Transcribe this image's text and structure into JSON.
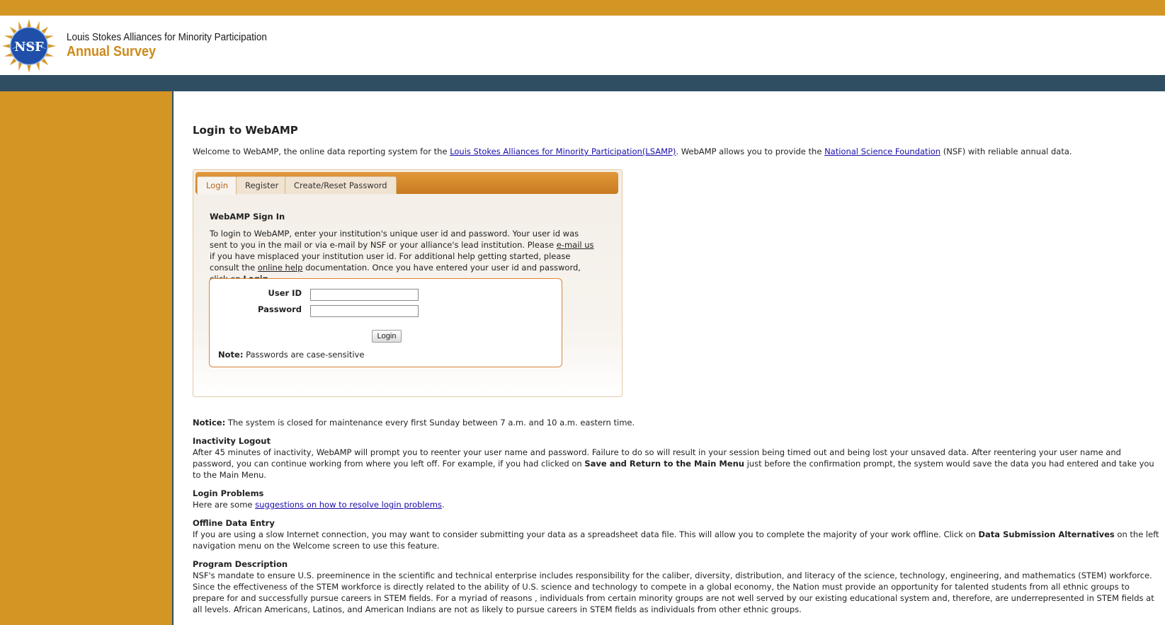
{
  "header": {
    "logo_label": "NSF",
    "title_line1": "Louis Stokes Alliances for Minority Participation",
    "title_line2": "Annual Survey"
  },
  "main": {
    "page_title": "Login to WebAMP",
    "welcome_prefix": "Welcome to WebAMP, the online data reporting system for the ",
    "lsamp_link": "Louis Stokes Alliances for Minority Participation(LSAMP)",
    "welcome_middle": ". WebAMP allows you to provide the ",
    "nsf_link": "National Science Foundation",
    "welcome_suffix": " (NSF) with reliable annual data."
  },
  "tabs": [
    "Login",
    "Register",
    "Create/Reset Password"
  ],
  "signin": {
    "title": "WebAMP Sign In",
    "text_1": "To login to WebAMP, enter your institution's unique user id and password. Your user id was sent to you in the mail or via e-mail by NSF or your alliance's lead institution. Please ",
    "email_link": "e-mail us",
    "text_2": " if you have misplaced your institution user id. For additional help getting started, please consult the ",
    "help_link": "online help",
    "text_3": " documentation. Once you have entered your user id and password, click on ",
    "text_bold": "Login.",
    "user_id_label": "User ID",
    "password_label": "Password",
    "user_id_value": "",
    "password_value": "",
    "login_button": "Login",
    "note_label": "Note:",
    "note_text": " Passwords are case-sensitive"
  },
  "notice": {
    "label": "Notice:",
    "text": " The system is closed for maintenance every first Sunday between 7 a.m. and 10 a.m. eastern time."
  },
  "inactivity": {
    "title": "Inactivity Logout",
    "text_1": "After 45 minutes of inactivity, WebAMP will prompt you to reenter your user name and password. Failure to do so will result in your session being timed out and being lost your unsaved data. After reentering your user name and password, you can continue working from where you left off. For example, if you had clicked on ",
    "bold": "Save and Return to the Main Menu",
    "text_2": " just before the confirmation prompt, the system would save the data you had entered and take you to the Main Menu."
  },
  "login_problems": {
    "title": "Login Problems",
    "prefix": "Here are some ",
    "link": "suggestions on how to resolve login problems",
    "suffix": "."
  },
  "offline": {
    "title": "Offline Data Entry",
    "text_1": "If you are using a slow Internet connection, you may want to consider submitting your data as a spreadsheet data file. This will allow you to complete the majority of your work offline. Click on ",
    "bold": "Data Submission Alternatives",
    "text_2": " on the left navigation menu on the Welcome screen to use this feature."
  },
  "program": {
    "title": "Program Description",
    "text": "NSF's mandate to ensure U.S. preeminence in the scientific and technical enterprise includes responsibility for the caliber, diversity, distribution, and literacy of the science, technology, engineering, and mathematics (STEM) workforce. Since the effectiveness of the STEM workforce is directly related to the ability of U.S. science and technology to compete in a global economy, the Nation must provide an opportunity for talented students from all ethnic groups to prepare for and successfully pursue careers in STEM fields. For a myriad of reasons , individuals from certain minority groups are not well served by our existing educational system and, therefore, are underrepresented in STEM fields at all levels. African Americans, Latinos, and American Indians are not as likely to pursue careers in STEM fields as individuals from other ethnic groups."
  },
  "colors": {
    "gold": "#d39524",
    "navy": "#2f4e62",
    "accent_text": "#cc8b1c"
  }
}
